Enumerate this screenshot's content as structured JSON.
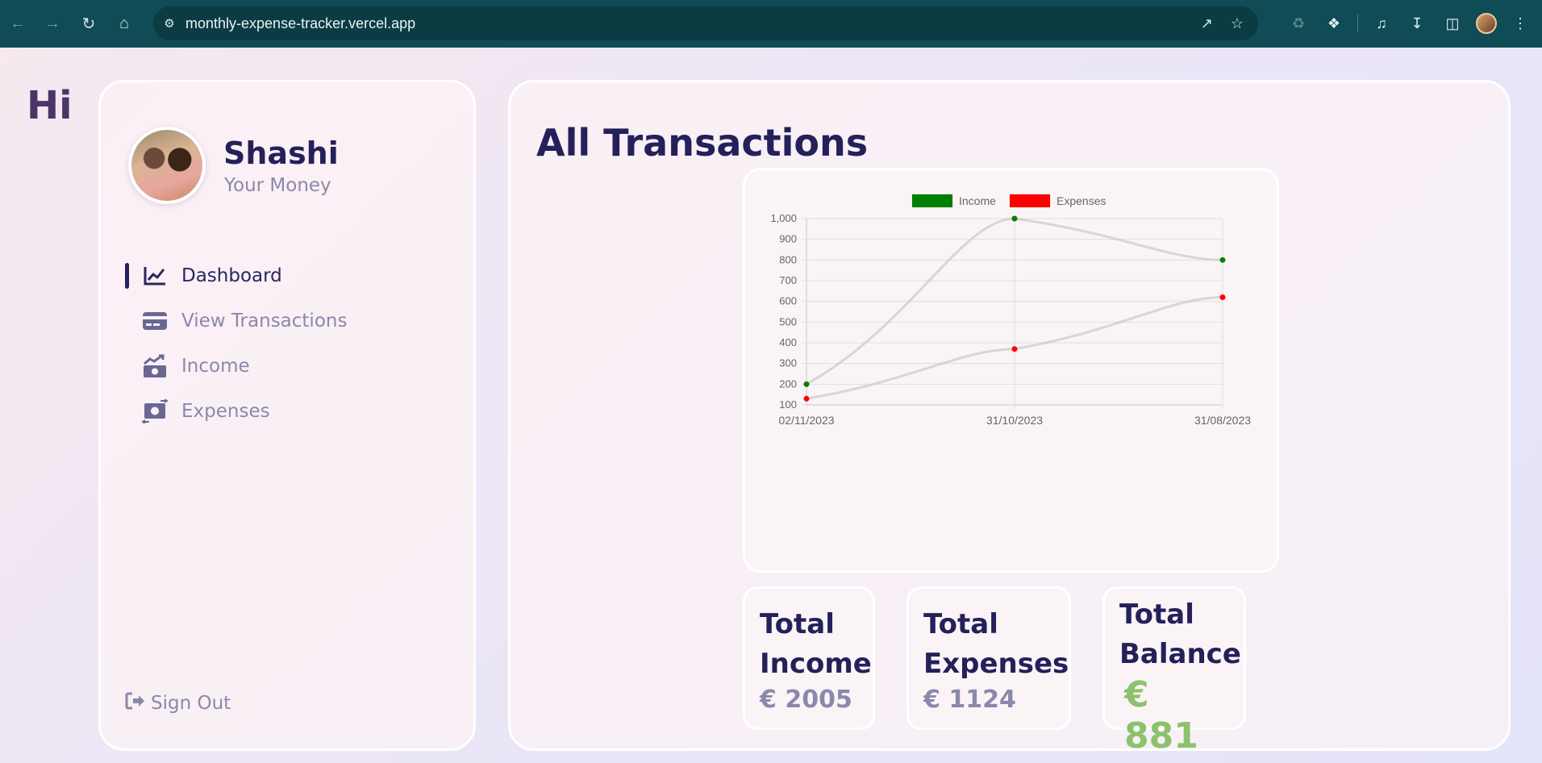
{
  "browser": {
    "url": "monthly-expense-tracker.vercel.app",
    "back_icon": "arrow-left-icon",
    "forward_icon": "arrow-right-icon",
    "reload_icon": "reload-icon",
    "home_icon": "home-icon"
  },
  "greeting": "Hi",
  "user": {
    "name": "Shashi",
    "subtitle": "Your Money"
  },
  "menu": {
    "items": [
      {
        "label": "Dashboard",
        "icon": "line-chart-icon",
        "active": true
      },
      {
        "label": "View Transactions",
        "icon": "credit-card-icon",
        "active": false
      },
      {
        "label": "Income",
        "icon": "money-up-icon",
        "active": false
      },
      {
        "label": "Expenses",
        "icon": "money-exchange-icon",
        "active": false
      }
    ],
    "signout": "Sign Out"
  },
  "main": {
    "title": "All Transactions"
  },
  "stats": {
    "income": {
      "title_1": "Total",
      "title_2": "Income",
      "value": "€ 2005"
    },
    "expenses": {
      "title_1": "Total",
      "title_2": "Expenses",
      "value": "€ 1124"
    },
    "balance": {
      "title_1": "Total",
      "title_2": "Balance",
      "value": "€ 881"
    }
  },
  "colors": {
    "income": "#008000",
    "expenses": "#ff0000",
    "balance_text": "#8cc26b",
    "title_text": "#24205a"
  },
  "chart_data": {
    "type": "line",
    "x": [
      "02/11/2023",
      "31/10/2023",
      "31/08/2023"
    ],
    "series": [
      {
        "name": "Income",
        "values": [
          200,
          1000,
          800
        ],
        "color": "#008000"
      },
      {
        "name": "Expenses",
        "values": [
          130,
          370,
          620
        ],
        "color": "#ff0000"
      }
    ],
    "y_ticks": [
      "100",
      "200",
      "300",
      "400",
      "500",
      "600",
      "700",
      "800",
      "900",
      "1,000"
    ],
    "ylim": [
      100,
      1000
    ],
    "grid": true,
    "legend_position": "top"
  }
}
